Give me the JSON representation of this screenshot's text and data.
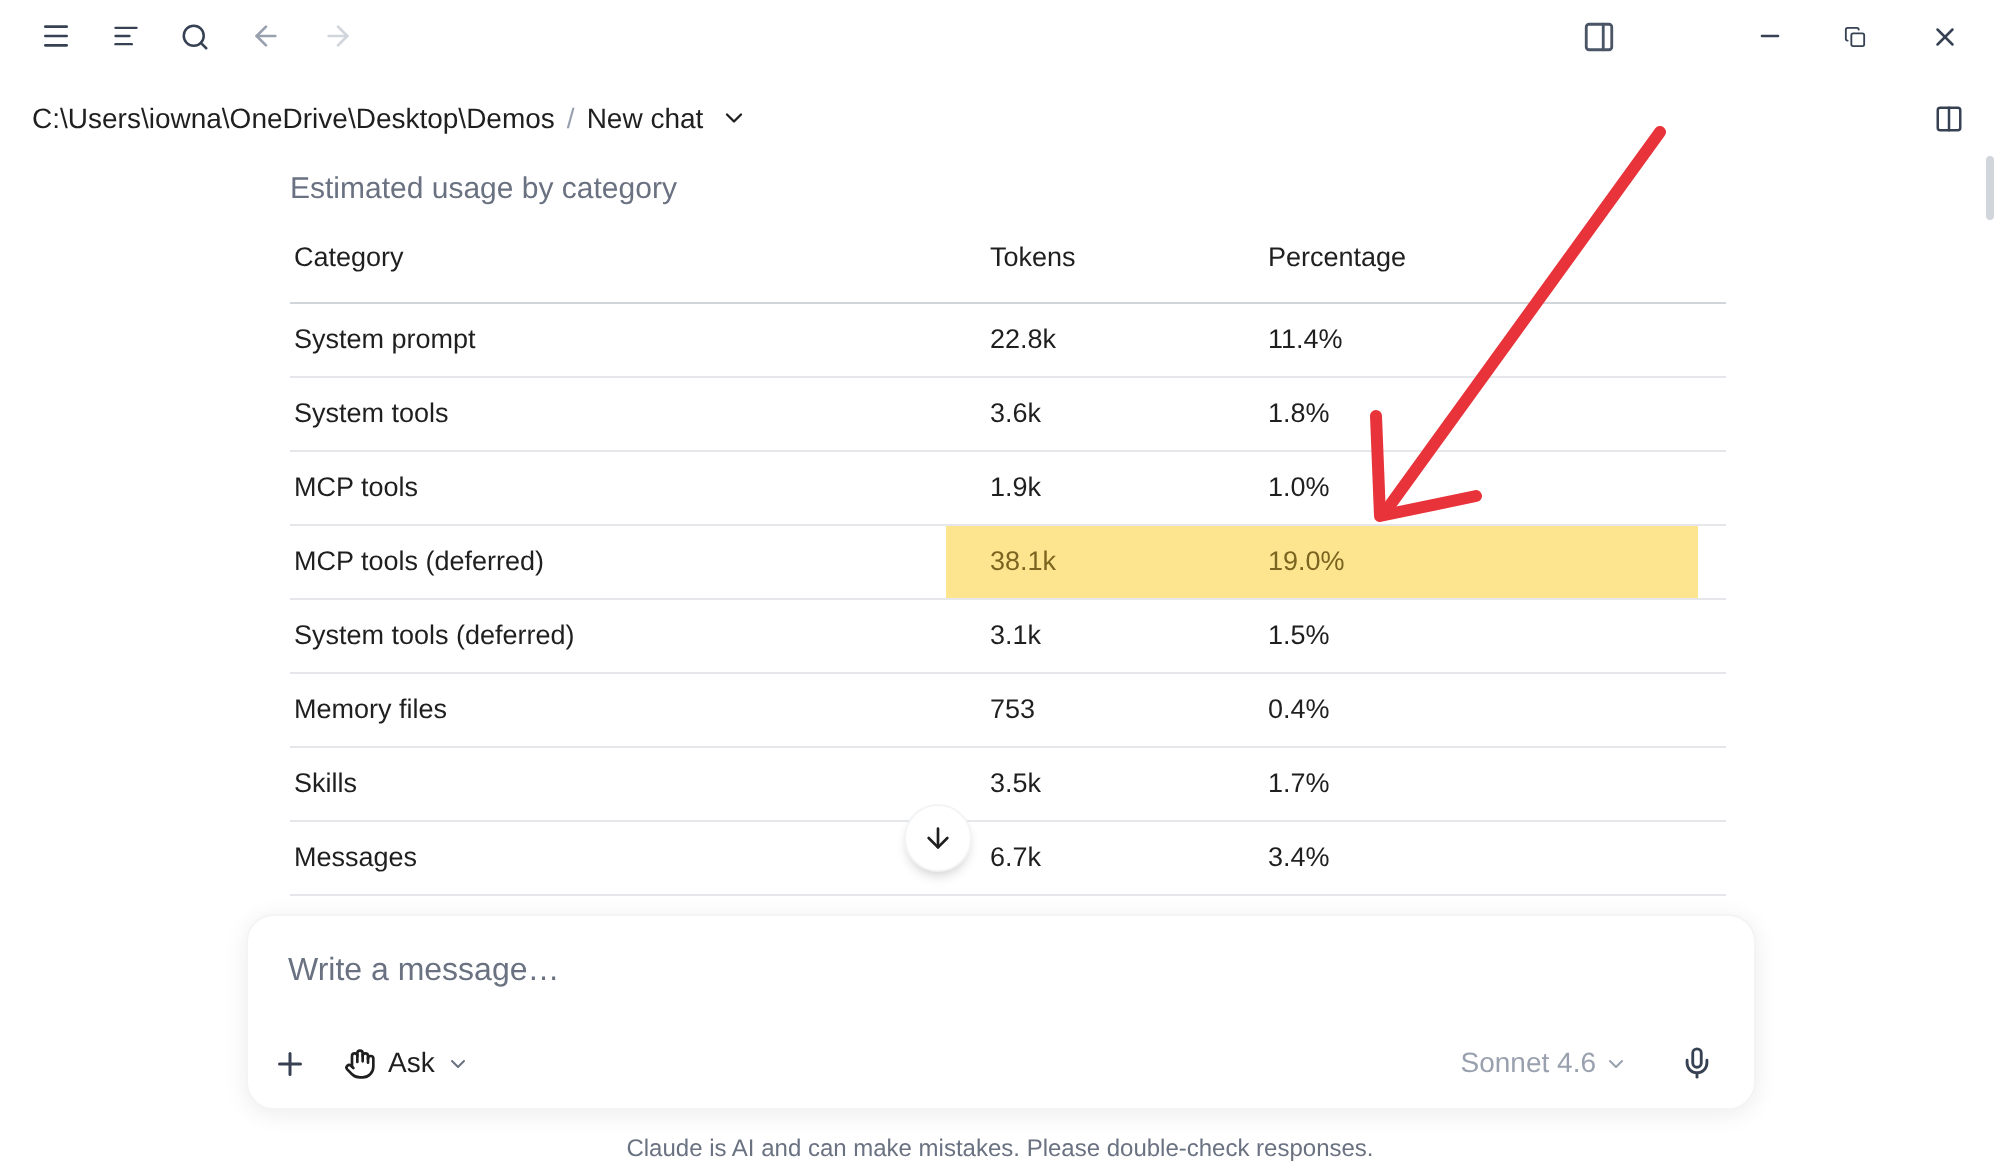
{
  "breadcrumb": {
    "path": "C:\\Users\\iowna\\OneDrive\\Desktop\\Demos",
    "separator": "/",
    "chat_title": "New chat"
  },
  "section_heading": "Estimated usage by category",
  "table": {
    "columns": [
      "Category",
      "Tokens",
      "Percentage"
    ],
    "rows": [
      {
        "category": "System prompt",
        "tokens": "22.8k",
        "percentage": "11.4%",
        "highlighted": false
      },
      {
        "category": "System tools",
        "tokens": "3.6k",
        "percentage": "1.8%",
        "highlighted": false
      },
      {
        "category": "MCP tools",
        "tokens": "1.9k",
        "percentage": "1.0%",
        "highlighted": false
      },
      {
        "category": "MCP tools (deferred)",
        "tokens": "38.1k",
        "percentage": "19.0%",
        "highlighted": true
      },
      {
        "category": "System tools (deferred)",
        "tokens": "3.1k",
        "percentage": "1.5%",
        "highlighted": false
      },
      {
        "category": "Memory files",
        "tokens": "753",
        "percentage": "0.4%",
        "highlighted": false
      },
      {
        "category": "Skills",
        "tokens": "3.5k",
        "percentage": "1.7%",
        "highlighted": false
      },
      {
        "category": "Messages",
        "tokens": "6.7k",
        "percentage": "3.4%",
        "highlighted": false
      }
    ]
  },
  "composer": {
    "placeholder": "Write a message…",
    "mode": "Ask",
    "model": "Sonnet 4.6"
  },
  "disclaimer": "Claude is AI and can make mistakes. Please double-check responses."
}
